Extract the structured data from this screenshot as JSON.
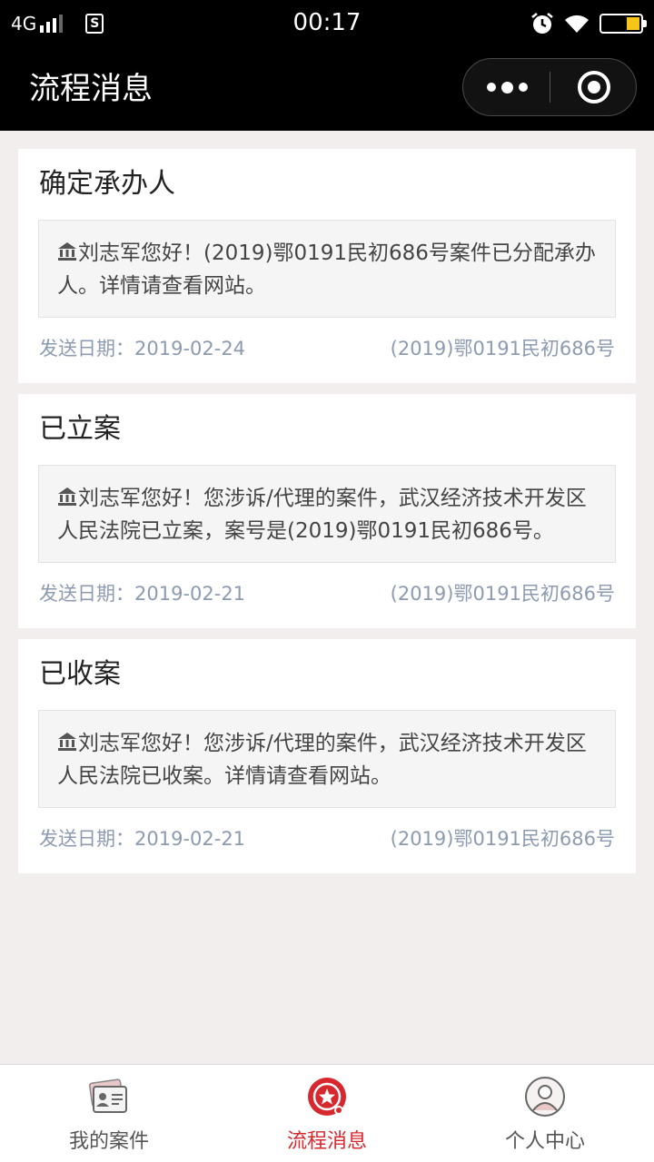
{
  "status_bar": {
    "network": "4G",
    "sim_label": "S",
    "time": "00:17"
  },
  "nav": {
    "title": "流程消息"
  },
  "messages": [
    {
      "title": "确定承办人",
      "body": "刘志军您好！(2019)鄂0191民初686号案件已分配承办人。详情请查看网站。",
      "date": "发送日期：2019-02-24",
      "case_no": "(2019)鄂0191民初686号"
    },
    {
      "title": "已立案",
      "body": "刘志军您好！您涉诉/代理的案件，武汉经济技术开发区人民法院已立案，案号是(2019)鄂0191民初686号。",
      "date": "发送日期：2019-02-21",
      "case_no": "(2019)鄂0191民初686号"
    },
    {
      "title": "已收案",
      "body": "刘志军您好！您涉诉/代理的案件，武汉经济技术开发区人民法院已收案。详情请查看网站。",
      "date": "发送日期：2019-02-21",
      "case_no": "(2019)鄂0191民初686号"
    }
  ],
  "tabs": [
    {
      "label": "我的案件",
      "icon": "id-card-icon",
      "active": false
    },
    {
      "label": "流程消息",
      "icon": "message-star-icon",
      "active": true
    },
    {
      "label": "个人中心",
      "icon": "person-icon",
      "active": false
    }
  ],
  "colors": {
    "accent": "#d6282e",
    "meta_text": "#8c9bb0",
    "page_bg": "#f1eeed",
    "battery_fill": "#f5c518"
  }
}
